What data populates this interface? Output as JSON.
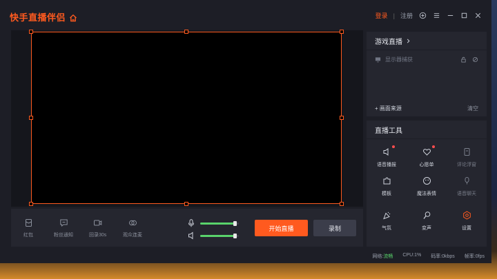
{
  "titlebar": {
    "brand": "快手直播伴侣",
    "login": "登录",
    "separator": "|",
    "register": "注册"
  },
  "toolbar": {
    "tools": [
      {
        "label": "红包",
        "icon": "envelope-icon"
      },
      {
        "label": "粉丝通知",
        "icon": "message-icon"
      },
      {
        "label": "回录30s",
        "icon": "video-icon"
      },
      {
        "label": "观众连麦",
        "icon": "link-circles-icon"
      }
    ],
    "mic_level": 0.9,
    "speaker_level": 0.9,
    "start_live_label": "开始直播",
    "record_label": "录制"
  },
  "source_panel": {
    "title": "游戏直播",
    "source_item": "显示器捕获",
    "add_source_label": "+ 画面来源",
    "clear_label": "清空"
  },
  "tools_panel": {
    "title": "直播工具",
    "items": [
      {
        "label": "语音播报",
        "icon": "speaker-icon",
        "badge": true,
        "dim": false
      },
      {
        "label": "心愿单",
        "icon": "heart-icon",
        "badge": true,
        "dim": false
      },
      {
        "label": "评论浮窗",
        "icon": "comment-window-icon",
        "badge": false,
        "dim": true
      },
      {
        "label": "模板",
        "icon": "puzzle-icon",
        "badge": false,
        "dim": false
      },
      {
        "label": "魔法表情",
        "icon": "smile-icon",
        "badge": false,
        "dim": false
      },
      {
        "label": "语音聊天",
        "icon": "mic-chat-icon",
        "badge": false,
        "dim": true
      },
      {
        "label": "气氛",
        "icon": "party-icon",
        "badge": false,
        "dim": false
      },
      {
        "label": "变声",
        "icon": "voice-change-icon",
        "badge": false,
        "dim": false
      },
      {
        "label": "设置",
        "icon": "gear-icon",
        "badge": false,
        "dim": false
      }
    ]
  },
  "statusbar": {
    "network_label": "网络:",
    "network_value": "流畅",
    "cpu": "CPU:1%",
    "bitrate": "码率:0kbps",
    "framerate": "帧率:0fps"
  },
  "colors": {
    "accent": "#ff5a1f",
    "good": "#59d36b",
    "badge": "#ff4d4f"
  }
}
